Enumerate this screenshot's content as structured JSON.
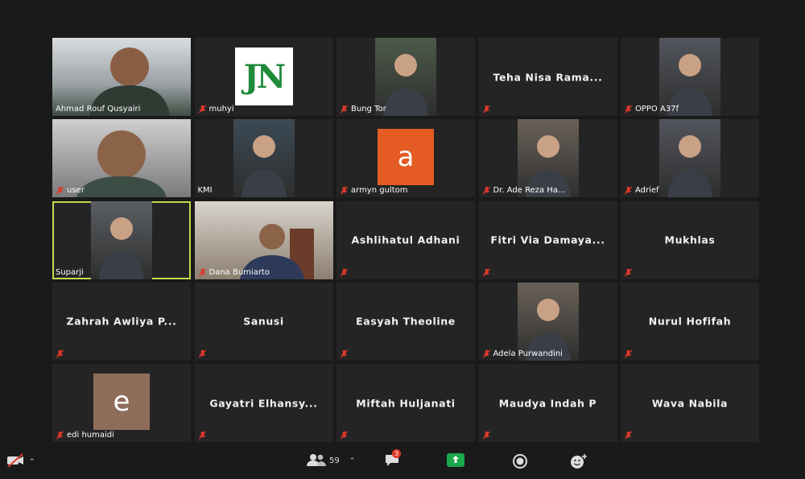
{
  "participants": [
    {
      "name": "Ahmad Rouf Qusyairi",
      "display": "video",
      "muted": false
    },
    {
      "name": "muhyi",
      "display": "logo",
      "logo_text": "JN",
      "muted": true
    },
    {
      "name": "Bung Tor",
      "display": "video",
      "muted": true
    },
    {
      "name": "Teha Nisa Rama...",
      "display": "name",
      "muted": true
    },
    {
      "name": "OPPO A37f",
      "display": "video",
      "muted": true
    },
    {
      "name": "user",
      "display": "video",
      "muted": true
    },
    {
      "name": "KMI",
      "display": "video",
      "muted": false
    },
    {
      "name": "armyn gultom",
      "display": "avatar",
      "avatar_letter": "a",
      "avatar_color": "#e55b24",
      "muted": true
    },
    {
      "name": "Dr. Ade Reza Ha...",
      "display": "video",
      "muted": true
    },
    {
      "name": "Adrief",
      "display": "video",
      "muted": true
    },
    {
      "name": "Suparji",
      "display": "video",
      "muted": false,
      "active_speaker": true
    },
    {
      "name": "Dana Bumiarto",
      "display": "video",
      "muted": true
    },
    {
      "name": "Ashlihatul Adhani",
      "display": "name",
      "muted": true
    },
    {
      "name": "Fitri Via Damaya...",
      "display": "name",
      "muted": true
    },
    {
      "name": "Mukhlas",
      "display": "name",
      "muted": true
    },
    {
      "name": "Zahrah Awliya P...",
      "display": "name",
      "muted": true
    },
    {
      "name": "Sanusi",
      "display": "name",
      "muted": true
    },
    {
      "name": "Easyah Theoline",
      "display": "name",
      "muted": true
    },
    {
      "name": "Adela Purwandini",
      "display": "video",
      "muted": true
    },
    {
      "name": "Nurul Hofifah",
      "display": "name",
      "muted": true
    },
    {
      "name": "edi humaidi",
      "display": "avatar",
      "avatar_letter": "e",
      "avatar_color": "#8e6e5b",
      "muted": true
    },
    {
      "name": "Gayatri Elhansy...",
      "display": "name",
      "muted": true
    },
    {
      "name": "Miftah Huljanati",
      "display": "name",
      "muted": true
    },
    {
      "name": "Maudya Indah P",
      "display": "name",
      "muted": true
    },
    {
      "name": "Wava Nabila",
      "display": "name",
      "muted": true
    }
  ],
  "toolbar": {
    "participants_count": "59",
    "chat_badge": "3",
    "icons": [
      "video-off-icon",
      "participants-icon",
      "chat-icon",
      "share-screen-icon",
      "record-icon",
      "reactions-icon"
    ]
  },
  "colors": {
    "background": "#1a1a1a",
    "tile": "#242424",
    "active_speaker": "#c9d94a",
    "mute": "#e0392b",
    "share": "#1aa84a"
  }
}
